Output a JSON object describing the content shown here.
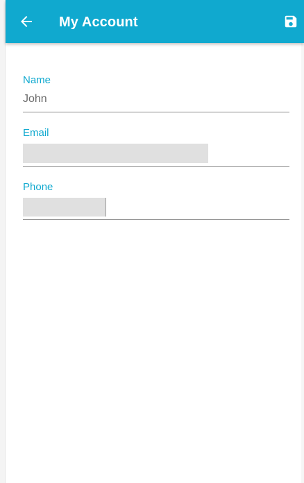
{
  "appbar": {
    "title": "My Account",
    "back_icon": "arrow-left-icon",
    "save_icon": "save-floppy-icon",
    "background_color": "#10a9cf"
  },
  "form": {
    "name": {
      "label": "Name",
      "value": "John"
    },
    "email": {
      "label": "Email",
      "value": ""
    },
    "phone": {
      "label": "Phone",
      "value": ""
    }
  },
  "colors": {
    "accent": "#10a9cf",
    "value_text": "#6a6a6a",
    "underline": "#8c8c8c"
  }
}
